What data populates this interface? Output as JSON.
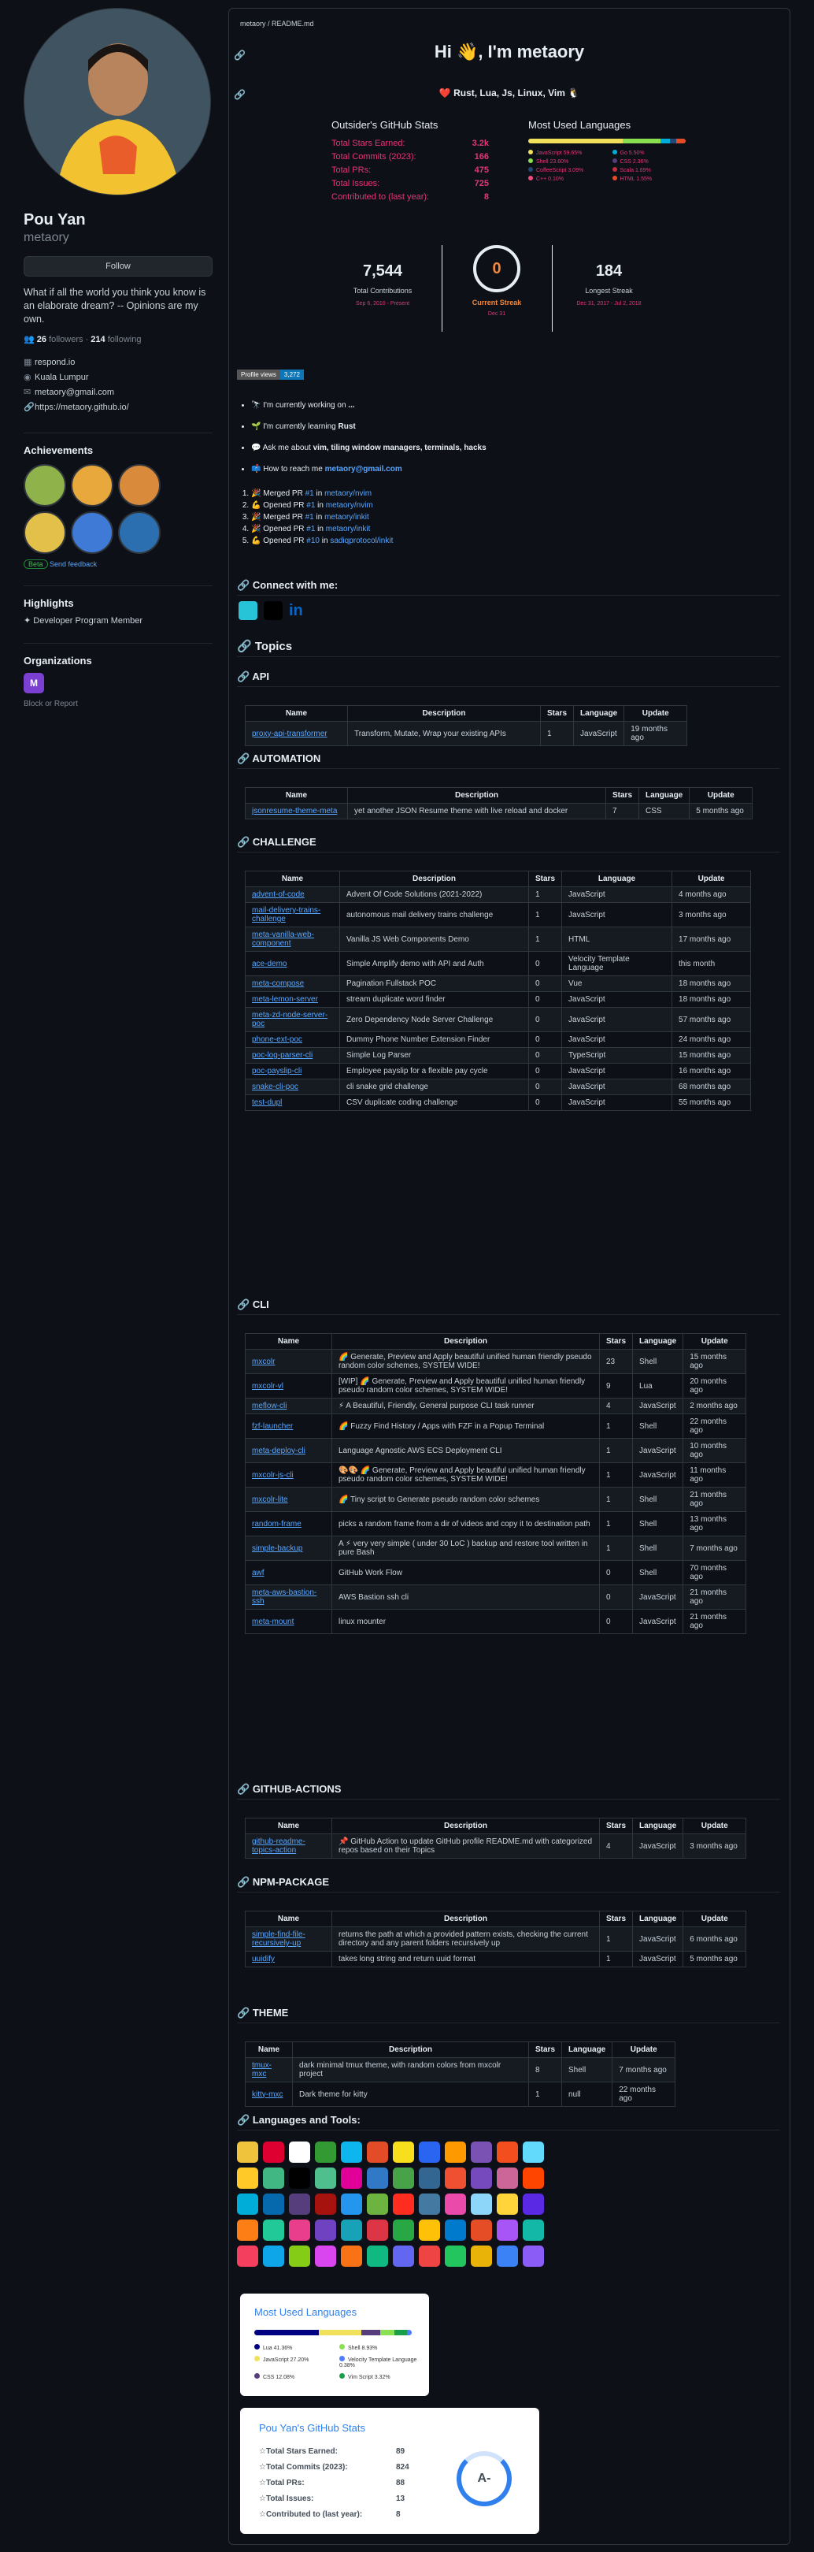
{
  "profile": {
    "name": "Pou Yan",
    "login": "metaory",
    "follow": "Follow",
    "bio": "What if all the world you think you know is an elaborate dream? -- Opinions are my own.",
    "followers": "26",
    "followers_label": "followers",
    "following": "214",
    "following_label": "following",
    "org": "respond.io",
    "location": "Kuala Lumpur",
    "email": "metaory@gmail.com",
    "url": "https://metaory.github.io/"
  },
  "sidebar": {
    "achievements": "Achievements",
    "beta": "Beta",
    "feedback": "Send feedback",
    "highlights": "Highlights",
    "highlight_item": "Developer Program Member",
    "organizations": "Organizations",
    "block": "Block or Report"
  },
  "readme": {
    "crumb": "metaory / README.md",
    "title": "Hi 👋, I'm metaory",
    "subtitle": "❤️ Rust, Lua, Js, Linux, Vim 🐧",
    "gh_stats_title": "Outsider's GitHub Stats",
    "stars_label": "Total Stars Earned:",
    "stars": "3.2k",
    "commits_label": "Total Commits (2023):",
    "commits": "166",
    "prs_label": "Total PRs:",
    "prs": "475",
    "issues_label": "Total Issues:",
    "issues": "725",
    "contrib_label": "Contributed to (last year):",
    "contrib": "8",
    "langs_title": "Most Used Languages",
    "langs": [
      {
        "n": "JavaScript 59.65%",
        "c": "#f1e05a"
      },
      {
        "n": "Go 5.50%",
        "c": "#00ADD8"
      },
      {
        "n": "Shell 23.60%",
        "c": "#89e051"
      },
      {
        "n": "CSS 2.36%",
        "c": "#563d7c"
      },
      {
        "n": "CoffeeScript 3.09%",
        "c": "#244776"
      },
      {
        "n": "Scala 1.69%",
        "c": "#c22d40"
      },
      {
        "n": "C++ 0.10%",
        "c": "#f34b7d"
      },
      {
        "n": "HTML 1.55%",
        "c": "#e34c26"
      }
    ],
    "total_contrib": "7,544",
    "total_contrib_label": "Total Contributions",
    "total_contrib_range": "Sep 6, 2010 - Present",
    "current_streak": "0",
    "current_streak_label": "Current Streak",
    "current_streak_date": "Dec 31",
    "longest_streak": "184",
    "longest_streak_label": "Longest Streak",
    "longest_streak_range": "Dec 31, 2017 - Jul 2, 2018",
    "views_label": "Profile views",
    "views": "3,272",
    "bullets": [
      {
        "icon": "🔭",
        "pre": "I'm currently working on ",
        "b": "..."
      },
      {
        "icon": "🌱",
        "pre": "I'm currently learning ",
        "b": "Rust"
      },
      {
        "icon": "💬",
        "pre": "Ask me about ",
        "b": "vim, tiling window managers, terminals, hacks"
      },
      {
        "icon": "📫",
        "pre": "How to reach me ",
        "b": "metaory@gmail.com"
      }
    ],
    "activity": [
      {
        "i": "🎉",
        "t": "Merged PR",
        "n": "#1",
        "r": "metaory/nvim"
      },
      {
        "i": "💪",
        "t": "Opened PR",
        "n": "#1",
        "r": "metaory/nvim"
      },
      {
        "i": "🎉",
        "t": "Merged PR",
        "n": "#1",
        "r": "metaory/inkit"
      },
      {
        "i": "🎉",
        "t": "Opened PR",
        "n": "#1",
        "r": "metaory/inkit"
      },
      {
        "i": "💪",
        "t": "Opened PR",
        "n": "#10",
        "r": "sadiqprotocol/inkit"
      }
    ],
    "connect": "Connect with me:",
    "topics": "Topics",
    "languages_tools": "Languages and Tools:"
  },
  "cols": {
    "name": "Name",
    "desc": "Description",
    "stars": "Stars",
    "lang": "Language",
    "update": "Update"
  },
  "sections": [
    {
      "title": "API",
      "rows": [
        [
          "proxy-api-transformer",
          "Transform, Mutate, Wrap your existing APIs",
          "1",
          "JavaScript",
          "19 months ago"
        ]
      ]
    },
    {
      "title": "AUTOMATION",
      "rows": [
        [
          "jsonresume-theme-meta",
          "yet another JSON Resume theme with live reload and docker",
          "7",
          "CSS",
          "5 months ago"
        ]
      ]
    },
    {
      "title": "CHALLENGE",
      "rows": [
        [
          "advent-of-code",
          "Advent Of Code Solutions (2021-2022)",
          "1",
          "JavaScript",
          "4 months ago"
        ],
        [
          "mail-delivery-trains-challenge",
          "autonomous mail delivery trains challenge",
          "1",
          "JavaScript",
          "3 months ago"
        ],
        [
          "meta-vanilla-web-component",
          "Vanilla JS Web Components Demo",
          "1",
          "HTML",
          "17 months ago"
        ],
        [
          "ace-demo",
          "Simple Amplify demo with API and Auth",
          "0",
          "Velocity Template Language",
          "this month"
        ],
        [
          "meta-compose",
          "Pagination Fullstack POC",
          "0",
          "Vue",
          "18 months ago"
        ],
        [
          "meta-lemon-server",
          "stream duplicate word finder",
          "0",
          "JavaScript",
          "18 months ago"
        ],
        [
          "meta-zd-node-server-poc",
          "Zero Dependency Node Server Challenge",
          "0",
          "JavaScript",
          "57 months ago"
        ],
        [
          "phone-ext-poc",
          "Dummy Phone Number Extension Finder",
          "0",
          "JavaScript",
          "24 months ago"
        ],
        [
          "poc-log-parser-cli",
          "Simple Log Parser",
          "0",
          "TypeScript",
          "15 months ago"
        ],
        [
          "poc-payslip-cli",
          "Employee payslip for a flexible pay cycle",
          "0",
          "JavaScript",
          "16 months ago"
        ],
        [
          "snake-cli-poc",
          "cli snake grid challenge",
          "0",
          "JavaScript",
          "68 months ago"
        ],
        [
          "test-dupl",
          "CSV duplicate coding challenge",
          "0",
          "JavaScript",
          "55 months ago"
        ]
      ]
    },
    {
      "title": "CLI",
      "rows": [
        [
          "mxcolr",
          "🌈 Generate, Preview and Apply beautiful unified human friendly pseudo random color schemes, SYSTEM WIDE!",
          "23",
          "Shell",
          "15 months ago"
        ],
        [
          "mxcolr-vl",
          "[WIP] 🌈 Generate, Preview and Apply beautiful unified human friendly pseudo random color schemes, SYSTEM WIDE!",
          "9",
          "Lua",
          "20 months ago"
        ],
        [
          "meflow-cli",
          "⚡ A Beautiful, Friendly, General purpose CLI task runner",
          "4",
          "JavaScript",
          "2 months ago"
        ],
        [
          "fzf-launcher",
          "🌈 Fuzzy Find History / Apps with FZF in a Popup Terminal",
          "1",
          "Shell",
          "22 months ago"
        ],
        [
          "meta-deploy-cli",
          "Language Agnostic AWS ECS Deployment CLI",
          "1",
          "JavaScript",
          "10 months ago"
        ],
        [
          "mxcolr-js-cli",
          "🎨🎨 🌈 Generate, Preview and Apply beautiful unified human friendly pseudo random color schemes, SYSTEM WIDE!",
          "1",
          "JavaScript",
          "11 months ago"
        ],
        [
          "mxcolr-lite",
          "🌈 Tiny script to Generate pseudo random color schemes",
          "1",
          "Shell",
          "21 months ago"
        ],
        [
          "random-frame",
          "picks a random frame from a dir of videos and copy it to destination path",
          "1",
          "Shell",
          "13 months ago"
        ],
        [
          "simple-backup",
          "A ⚡ very very simple ( under 30 LoC ) backup and restore tool written in pure Bash",
          "1",
          "Shell",
          "7 months ago"
        ],
        [
          "awf",
          "GitHub Work Flow",
          "0",
          "Shell",
          "70 months ago"
        ],
        [
          "meta-aws-bastion-ssh",
          "AWS Bastion ssh cli",
          "0",
          "JavaScript",
          "21 months ago"
        ],
        [
          "meta-mount",
          "linux mounter",
          "0",
          "JavaScript",
          "21 months ago"
        ]
      ]
    },
    {
      "title": "GITHUB-ACTIONS",
      "rows": [
        [
          "github-readme-topics-action",
          "📌 GitHub Action to update GitHub profile README.md with categorized repos based on their Topics",
          "4",
          "JavaScript",
          "3 months ago"
        ]
      ]
    },
    {
      "title": "NPM-PACKAGE",
      "rows": [
        [
          "simple-find-file-recursively-up",
          "returns the path at which a provided pattern exists, checking the current directory and any parent folders recursively up",
          "1",
          "JavaScript",
          "6 months ago"
        ],
        [
          "uuidify",
          "takes long string and return uuid format",
          "1",
          "JavaScript",
          "5 months ago"
        ]
      ]
    },
    {
      "title": "THEME",
      "rows": [
        [
          "tmux-mxc",
          "dark minimal tmux theme, with random colors from mxcolr project",
          "8",
          "Shell",
          "7 months ago"
        ],
        [
          "kitty-mxc",
          "Dark theme for kitty",
          "1",
          "null",
          "22 months ago"
        ]
      ]
    }
  ],
  "lang_card": {
    "title": "Most Used Languages",
    "items": [
      {
        "n": "Lua 41.36%",
        "c": "#000080"
      },
      {
        "n": "Shell 8.93%",
        "c": "#89e051"
      },
      {
        "n": "JavaScript 27.20%",
        "c": "#f1e05a"
      },
      {
        "n": "Velocity Template Language 0.38%",
        "c": "#507cff"
      },
      {
        "n": "CSS 12.08%",
        "c": "#563d7c"
      },
      {
        "n": "Vim Script 3.32%",
        "c": "#199f4b"
      }
    ]
  },
  "stats_card": {
    "title": "Pou Yan's GitHub Stats",
    "rows": [
      {
        "l": "Total Stars Earned:",
        "v": "89"
      },
      {
        "l": "Total Commits (2023):",
        "v": "824"
      },
      {
        "l": "Total PRs:",
        "v": "88"
      },
      {
        "l": "Total Issues:",
        "v": "13"
      },
      {
        "l": "Contributed to (last year):",
        "v": "8"
      }
    ],
    "grade": "A-"
  }
}
